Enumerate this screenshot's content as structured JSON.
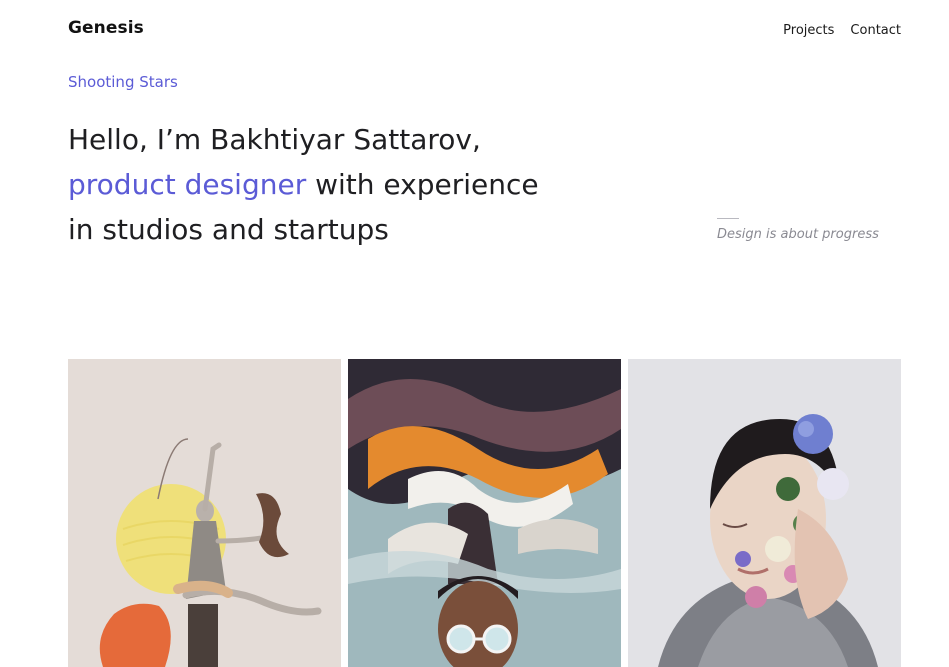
{
  "header": {
    "logo": "Genesis",
    "nav": [
      {
        "label": "Projects"
      },
      {
        "label": "Contact"
      }
    ]
  },
  "hero": {
    "eyebrow": "Shooting Stars",
    "line1": "Hello, I’m Bakhtiyar Sattarov,",
    "line2_accent": "product designer",
    "line2_rest": " with experience",
    "line3": "in studios and startups",
    "tagline": "Design is about progress"
  },
  "colors": {
    "accent": "#5b5bd6",
    "text": "#1f1f22",
    "muted": "#8a8a92"
  },
  "gallery": [
    {
      "name": "dancer-collage-image"
    },
    {
      "name": "abstract-flow-portrait-image"
    },
    {
      "name": "floral-face-portrait-image"
    }
  ]
}
